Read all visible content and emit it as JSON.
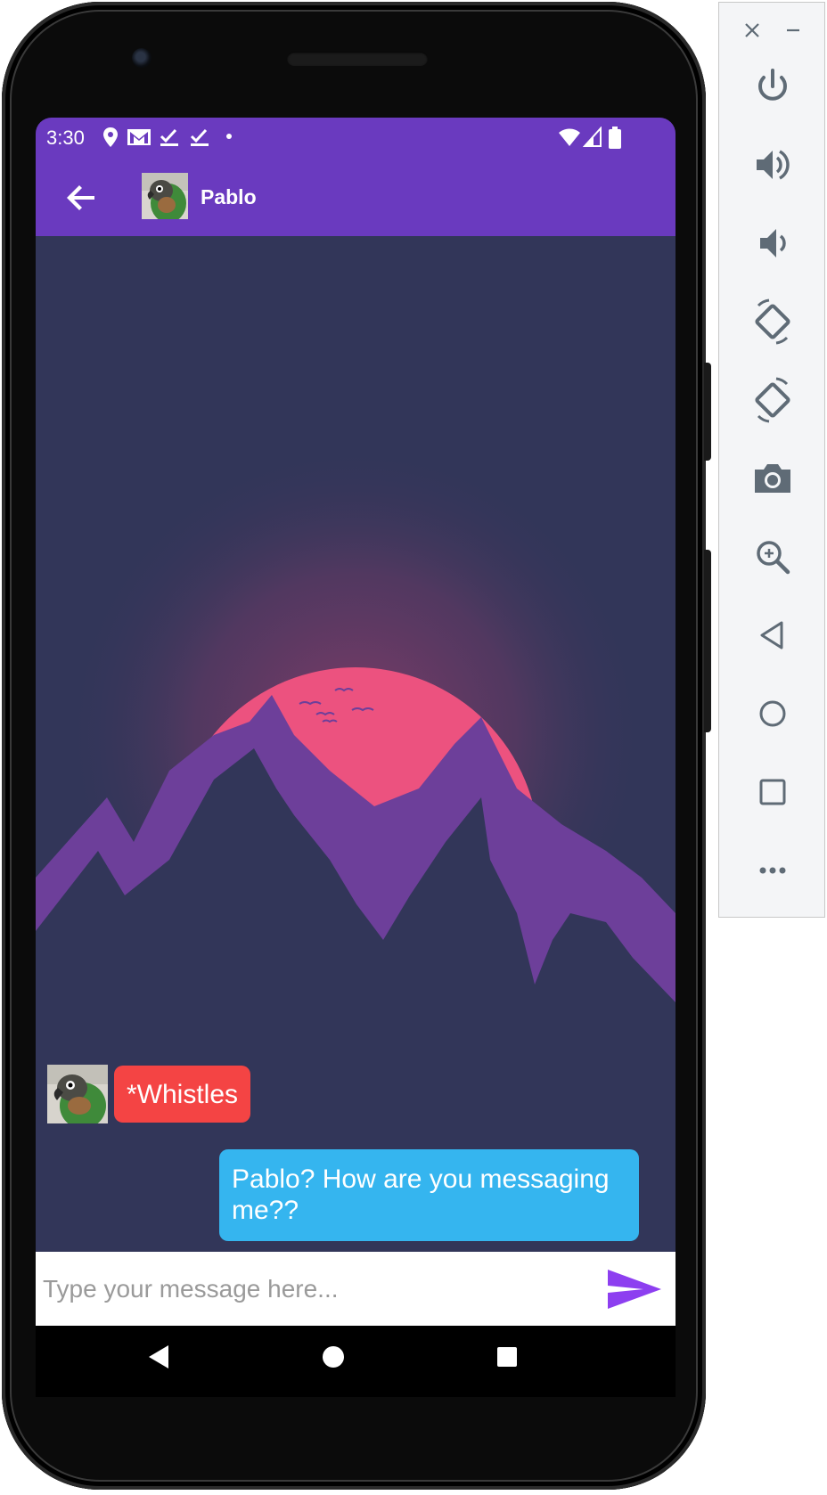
{
  "status_bar": {
    "time": "3:30",
    "left_icons": [
      "location-icon",
      "gmail-icon",
      "task-done-icon",
      "task-done-icon",
      "dot-icon"
    ],
    "right_icons": [
      "wifi-icon",
      "signal-icon",
      "battery-icon"
    ]
  },
  "app_bar": {
    "back_icon": "arrow-left-icon",
    "contact_name": "Pablo",
    "color": "#6a3abf"
  },
  "chat": {
    "messages": [
      {
        "direction": "incoming",
        "text": "*Whistles",
        "bubble_color": "#f44444"
      },
      {
        "direction": "outgoing",
        "text": "Pablo? How are you messaging me??",
        "bubble_color": "#35b5ef"
      }
    ],
    "wallpaper": {
      "sky_color": "#323659",
      "sun_color": "#ec527f",
      "mountain_color": "#6d3f9a"
    }
  },
  "input": {
    "placeholder": "Type your message here...",
    "value": "",
    "send_icon": "send-icon",
    "send_color": "#8d3ff0"
  },
  "nav_bar": {
    "icons": [
      "nav-back-icon",
      "nav-home-icon",
      "nav-recents-icon"
    ]
  },
  "emulator_toolbar": {
    "window_buttons": [
      "close-icon",
      "minimize-icon"
    ],
    "buttons": [
      "power-icon",
      "volume-up-icon",
      "volume-down-icon",
      "rotate-left-icon",
      "rotate-right-icon",
      "camera-icon",
      "zoom-icon",
      "back-icon",
      "home-icon",
      "overview-icon",
      "more-icon"
    ],
    "icon_color": "#5f6b76"
  }
}
